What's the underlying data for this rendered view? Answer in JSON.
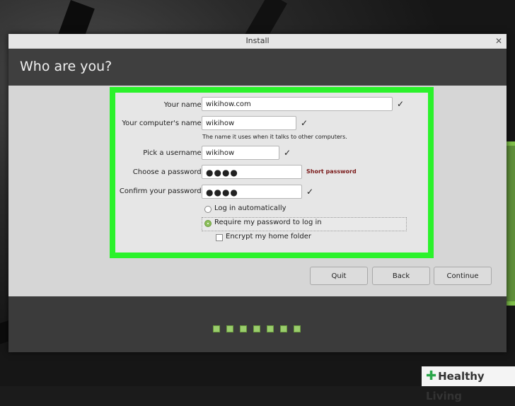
{
  "window": {
    "title": "Install",
    "close_glyph": "✕",
    "page_title": "Who are you?"
  },
  "form": {
    "name_label": "Your name:",
    "name_value": "wikihow.com",
    "computer_label": "Your computer's name:",
    "computer_value": "wikihow",
    "computer_hint": "The name it uses when it talks to other computers.",
    "username_label": "Pick a username:",
    "username_value": "wikihow",
    "password_label": "Choose a password:",
    "password_value": "●●●●",
    "password_warning": "Short password",
    "confirm_label": "Confirm your password:",
    "confirm_value": "●●●●",
    "check_glyph": "✓",
    "login_auto_label": "Log in automatically",
    "require_password_label": "Require my password to log in",
    "encrypt_label": "Encrypt my home folder"
  },
  "buttons": {
    "quit": "Quit",
    "back": "Back",
    "continue": "Continue"
  },
  "progress": {
    "total_steps": 7
  },
  "watermark": {
    "plus": "✚",
    "text": "Healthy Living"
  },
  "colors": {
    "highlight": "#2bf22b",
    "accent_green": "#8cbf5a",
    "warning": "#7a1a1a"
  }
}
